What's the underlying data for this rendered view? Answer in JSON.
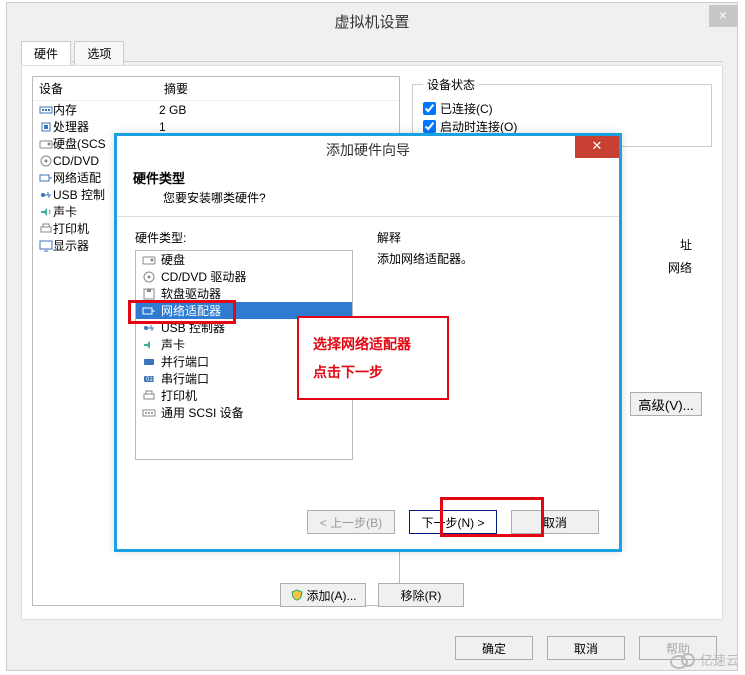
{
  "main": {
    "title": "虚拟机设置",
    "tabs": [
      {
        "label": "硬件",
        "active": true
      },
      {
        "label": "选项",
        "active": false
      }
    ],
    "columns": {
      "device": "设备",
      "summary": "摘要"
    },
    "hardware_rows": [
      {
        "icon": "memory-icon",
        "name": "内存",
        "summary": "2 GB"
      },
      {
        "icon": "cpu-icon",
        "name": "处理器",
        "summary": "1"
      },
      {
        "icon": "disk-icon",
        "name": "硬盘(SCS",
        "summary": ""
      },
      {
        "icon": "cd-icon",
        "name": "CD/DVD",
        "summary": ""
      },
      {
        "icon": "nic-icon",
        "name": "网络适配",
        "summary": ""
      },
      {
        "icon": "usb-icon",
        "name": "USB 控制",
        "summary": ""
      },
      {
        "icon": "sound-icon",
        "name": "声卡",
        "summary": ""
      },
      {
        "icon": "printer-icon",
        "name": "打印机",
        "summary": ""
      },
      {
        "icon": "display-icon",
        "name": "显示器",
        "summary": ""
      }
    ],
    "status_group": {
      "legend": "设备状态",
      "connected": "已连接(C)",
      "connect_at_power_on": "启动时连接(O)",
      "connected_checked": true,
      "connect_power_checked": true
    },
    "side_labels": {
      "address": "址",
      "network": "网络"
    },
    "advanced_btn": "高级(V)...",
    "add_btn": "添加(A)...",
    "remove_btn": "移除(R)",
    "ok_btn": "确定",
    "cancel_btn": "取消",
    "help_btn": "帮助"
  },
  "wizard": {
    "title": "添加硬件向导",
    "header_title": "硬件类型",
    "header_sub": "您要安装哪类硬件?",
    "type_label": "硬件类型:",
    "exp_label": "解释",
    "exp_text": "添加网络适配器。",
    "types": [
      {
        "icon": "disk-icon",
        "label": "硬盘"
      },
      {
        "icon": "cd-icon",
        "label": "CD/DVD 驱动器"
      },
      {
        "icon": "floppy-icon",
        "label": "软盘驱动器"
      },
      {
        "icon": "nic-icon",
        "label": "网络适配器",
        "selected": true
      },
      {
        "icon": "usb-icon",
        "label": "USB 控制器"
      },
      {
        "icon": "sound-icon",
        "label": "声卡"
      },
      {
        "icon": "parallel-icon",
        "label": "并行端口"
      },
      {
        "icon": "serial-icon",
        "label": "串行端口"
      },
      {
        "icon": "printer-icon",
        "label": "打印机"
      },
      {
        "icon": "scsi-icon",
        "label": "通用 SCSI 设备"
      }
    ],
    "back_btn": "< 上一步(B)",
    "next_btn": "下一步(N) >",
    "cancel_btn": "取消"
  },
  "annotation": {
    "line1": "选择网络适配器",
    "line2": "点击下一步"
  },
  "watermark": "亿速云",
  "colors": {
    "wizard_border": "#1ba1e2",
    "highlight_red": "#e30613",
    "close_red": "#c84031",
    "selection_blue": "#2e7bd1"
  }
}
